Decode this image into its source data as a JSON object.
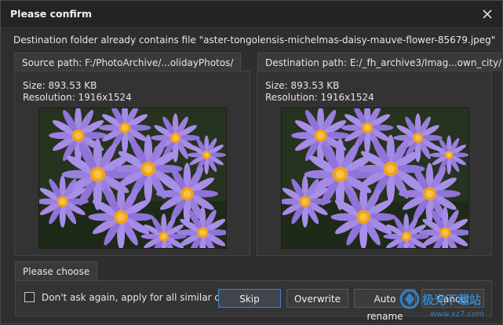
{
  "window": {
    "title": "Please confirm"
  },
  "message": "Destination folder already contains file \"aster-tongolensis-michelmas-daisy-mauve-flower-85679.jpeg\"",
  "source": {
    "tab_label": "Source path: F:/PhotoArchive/...olidayPhotos/",
    "size": "Size: 893.53 KB",
    "resolution": "Resolution: 1916x1524"
  },
  "destination": {
    "tab_label": "Destination path: E:/_fh_archive3/Imag...own_city/",
    "size": "Size: 893.53 KB",
    "resolution": "Resolution: 1916x1524"
  },
  "choose": {
    "tab_label": "Please choose",
    "dont_ask_label": "Don't ask again, apply for all similar cases",
    "dont_ask_checked": false
  },
  "buttons": {
    "skip": "Skip",
    "overwrite": "Overwrite",
    "auto_rename": "Auto rename",
    "cancel": "Cancel"
  },
  "colors": {
    "accent": "#3a84d6",
    "petal": "#9a7fe0",
    "center": "#f0a020"
  },
  "watermark": {
    "brand": "极光下载站",
    "url": "www.xz7.com"
  }
}
